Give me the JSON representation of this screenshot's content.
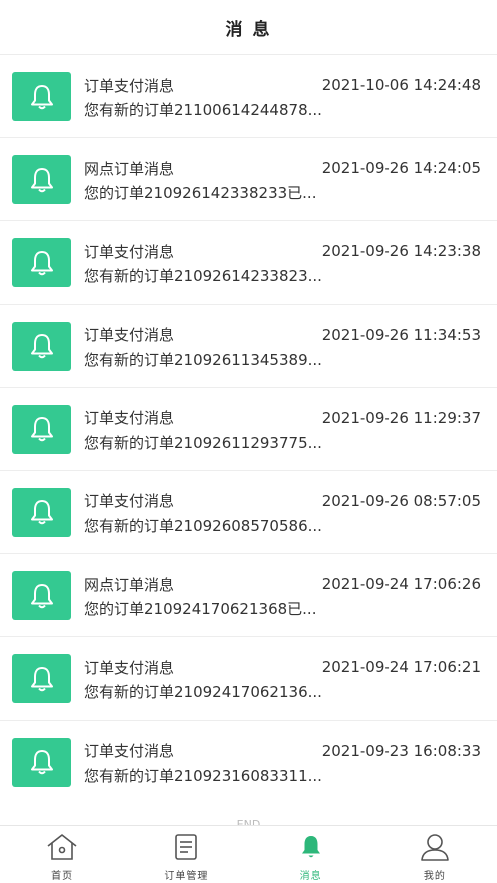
{
  "header": {
    "title": "消 息"
  },
  "colors": {
    "accent": "#34c991",
    "active_tab": "#2db77a"
  },
  "messages": [
    {
      "title": "订单支付消息",
      "time": "2021-10-06 14:24:48",
      "preview": "您有新的订单21100614244878..."
    },
    {
      "title": "网点订单消息",
      "time": "2021-09-26 14:24:05",
      "preview": "您的订单210926142338233已..."
    },
    {
      "title": "订单支付消息",
      "time": "2021-09-26 14:23:38",
      "preview": "您有新的订单21092614233823..."
    },
    {
      "title": "订单支付消息",
      "time": "2021-09-26 11:34:53",
      "preview": "您有新的订单21092611345389..."
    },
    {
      "title": "订单支付消息",
      "time": "2021-09-26 11:29:37",
      "preview": "您有新的订单21092611293775..."
    },
    {
      "title": "订单支付消息",
      "time": "2021-09-26 08:57:05",
      "preview": "您有新的订单21092608570586..."
    },
    {
      "title": "网点订单消息",
      "time": "2021-09-24 17:06:26",
      "preview": "您的订单210924170621368已..."
    },
    {
      "title": "订单支付消息",
      "time": "2021-09-24 17:06:21",
      "preview": "您有新的订单21092417062136..."
    },
    {
      "title": "订单支付消息",
      "time": "2021-09-23 16:08:33",
      "preview": "您有新的订单21092316083311..."
    }
  ],
  "end_text": "END",
  "tabbar": {
    "tabs": [
      {
        "label": "首页",
        "icon": "home-icon"
      },
      {
        "label": "订单管理",
        "icon": "order-list-icon"
      },
      {
        "label": "消息",
        "icon": "bell-icon"
      },
      {
        "label": "我的",
        "icon": "user-icon"
      }
    ],
    "active_index": 2
  }
}
